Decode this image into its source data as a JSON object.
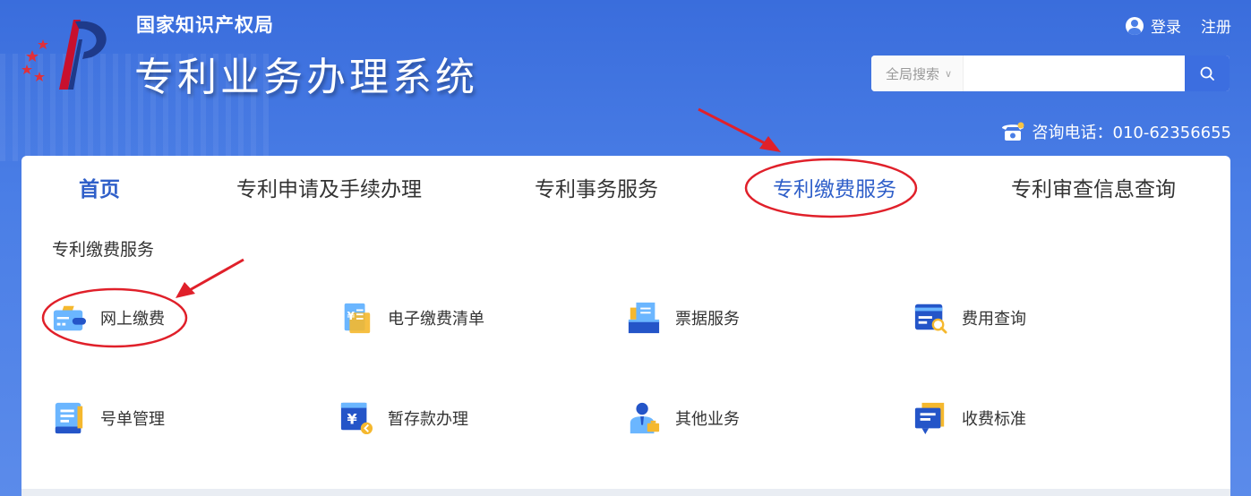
{
  "header": {
    "org_name": "国家知识产权局",
    "system_name": "专利业务办理系统",
    "login_label": "登录",
    "register_label": "注册",
    "search_scope": "全局搜索",
    "search_placeholder": "",
    "phone_label": "咨询电话：010-62356655"
  },
  "nav": {
    "items": [
      {
        "label": "首页"
      },
      {
        "label": "专利申请及手续办理"
      },
      {
        "label": "专利事务服务"
      },
      {
        "label": "专利缴费服务"
      },
      {
        "label": "专利审查信息查询"
      }
    ],
    "active": "专利缴费服务"
  },
  "section": {
    "title": "专利缴费服务",
    "services": [
      {
        "label": "网上缴费",
        "icon": "wallet-icon"
      },
      {
        "label": "电子缴费清单",
        "icon": "yuan-list-icon"
      },
      {
        "label": "票据服务",
        "icon": "receipt-tray-icon"
      },
      {
        "label": "费用查询",
        "icon": "card-search-icon"
      },
      {
        "label": "号单管理",
        "icon": "document-list-icon"
      },
      {
        "label": "暂存款办理",
        "icon": "yuan-deposit-icon"
      },
      {
        "label": "其他业务",
        "icon": "person-briefcase-icon"
      },
      {
        "label": "收费标准",
        "icon": "standard-doc-icon"
      }
    ]
  },
  "colors": {
    "brand_blue": "#3c6ee0",
    "active_nav": "#2f5fc9",
    "annotation_red": "#e0202a"
  }
}
